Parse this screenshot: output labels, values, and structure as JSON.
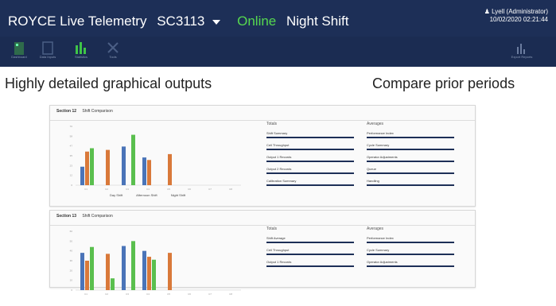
{
  "header": {
    "app_name": "ROYCE Live Telemetry",
    "site": "SC3113",
    "status": "Online",
    "shift": "Night Shift",
    "user_name": "Lyell (Administrator)",
    "user_datetime": "10/02/2020 02:21:44"
  },
  "nav": {
    "items": [
      {
        "label": "Dashboard",
        "icon": "building-icon"
      },
      {
        "label": "Data Inputs",
        "icon": "document-icon"
      },
      {
        "label": "Statistics",
        "icon": "bar-chart-icon"
      },
      {
        "label": "Tools",
        "icon": "tools-icon"
      },
      {
        "label": "Export Reports",
        "icon": "chart-export-icon"
      }
    ]
  },
  "headlines": {
    "left": "Highly detailed graphical outputs",
    "right": "Compare prior periods"
  },
  "colors": {
    "header": "#1d2f57",
    "online": "#56d84f",
    "blue": "#4a74b8",
    "orange": "#d9793a",
    "green": "#5abf4e"
  },
  "panels": [
    {
      "title": "Section 12",
      "subtitle": "Shift Comparison",
      "left_heading": "Totals",
      "right_heading": "Averages",
      "left_metrics": [
        "Shift Summary",
        "Cell Throughput",
        "Output 1 Records",
        "Output 2 Records",
        "Calibration Summary"
      ],
      "right_metrics": [
        "Performance Index",
        "Cycle Summary",
        "Operator Adjustments",
        "Queue",
        "Handling"
      ],
      "legend": [
        "Day Shift",
        "Afternoon Shift",
        "Night Shift"
      ]
    },
    {
      "title": "Section 13",
      "subtitle": "Shift Comparison",
      "left_heading": "Totals",
      "right_heading": "Averages",
      "left_metrics": [
        "Shift Average",
        "Cell Throughput",
        "Output 1 Records"
      ],
      "right_metrics": [
        "Performance Index",
        "Cycle Summary",
        "Operator Adjustments"
      ],
      "legend": []
    }
  ],
  "chart_data": [
    {
      "type": "bar",
      "categories": [
        "C1",
        "C2",
        "C3",
        "C4",
        "C5",
        "C6",
        "C7",
        "C8"
      ],
      "series": [
        {
          "name": "Day Shift",
          "values": [
            22,
            0,
            46,
            33,
            0,
            0,
            0,
            0
          ]
        },
        {
          "name": "Afternoon Shift",
          "values": [
            40,
            42,
            0,
            30,
            37,
            0,
            0,
            0
          ]
        },
        {
          "name": "Night Shift",
          "values": [
            44,
            0,
            60,
            0,
            0,
            0,
            0,
            0
          ]
        }
      ],
      "ylim": [
        0,
        70
      ]
    },
    {
      "type": "bar",
      "categories": [
        "C1",
        "C2",
        "C3",
        "C4",
        "C5",
        "C6",
        "C7",
        "C8"
      ],
      "series": [
        {
          "values": [
            38,
            0,
            45,
            40,
            0,
            0,
            0,
            0
          ]
        },
        {
          "values": [
            30,
            37,
            0,
            34,
            38,
            0,
            0,
            0
          ]
        },
        {
          "values": [
            44,
            12,
            50,
            31,
            0,
            0,
            0,
            0
          ]
        }
      ],
      "ylim": [
        0,
        60
      ]
    }
  ]
}
